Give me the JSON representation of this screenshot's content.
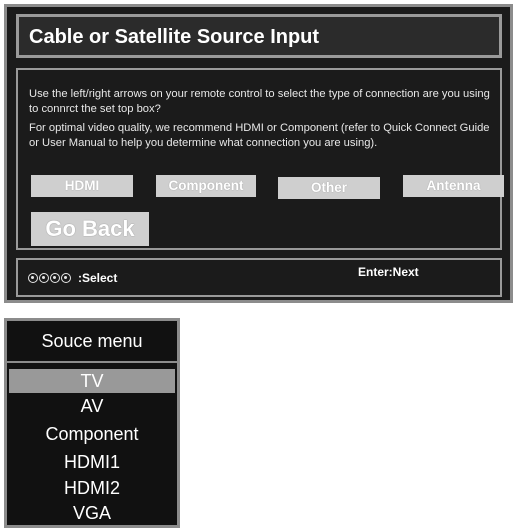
{
  "dialog": {
    "title": "Cable or Satellite Source Input",
    "instruction": "Use the left/right arrows on your remote control to select the type of connection are you using to connrct the set top box?",
    "recommendation": "For optimal video quality, we recommend HDMI or Component (refer to Quick Connect Guide or User Manual to help you determine what connection you are using).",
    "options": [
      "HDMI",
      "Component",
      "Other",
      "Antenna"
    ],
    "go_back": "Go Back",
    "footer": {
      "select_label": ":Select",
      "enter_label": "Enter:Next"
    }
  },
  "source_menu": {
    "title": "Souce menu",
    "items": [
      "TV",
      "AV",
      "Component",
      "HDMI1",
      "HDMI2",
      "VGA"
    ],
    "selected": "TV"
  }
}
